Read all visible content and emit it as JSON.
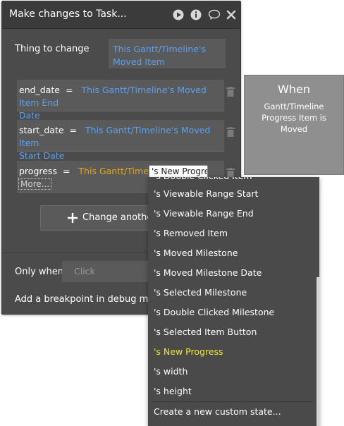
{
  "panel": {
    "title": "Make changes to Task...",
    "thing_label": "Thing to change",
    "thing_value_line1": "This Gantt/Timeline's",
    "thing_value_line2": "Moved Item",
    "fields": [
      {
        "name": "end_date",
        "op": "=",
        "expr_line1": "This Gantt/Timeline's Moved Item End",
        "expr_line2": "Date"
      },
      {
        "name": "start_date",
        "op": "=",
        "expr_line1": "This Gantt/Timeline's Moved Item",
        "expr_line2": "Start Date"
      },
      {
        "name": "progress",
        "op": "=",
        "expr_prefix": "This Gantt/Timeline",
        "expr_editing": "'s New Progre"
      }
    ],
    "more_label": "More...",
    "change_another_label": "Change another",
    "only_when_label": "Only when",
    "only_when_placeholder": "Click",
    "breakpoint_label": "Add a breakpoint in debug mode"
  },
  "when_box": {
    "title": "When",
    "line1": "Gantt/Timeline",
    "line2": "Progress Item is",
    "line3": "Moved"
  },
  "dropdown": {
    "items": [
      "'s Viewable Range Start",
      "'s Viewable Range End",
      "'s Removed Item",
      "'s Moved Milestone",
      "'s Moved Milestone Date",
      "'s Selected Milestone",
      "'s Double Clicked Milestone",
      "'s Selected Item Button",
      "'s New Progress",
      "'s width",
      "'s height"
    ],
    "highlighted_index": 8,
    "highlight_color": "#f5e532",
    "create_state_label": "Create a new custom state..."
  },
  "colors": {
    "panel_bg": "#4b4b4b",
    "expression_blue": "#5aa0ef",
    "expression_yellow": "#e3a51c"
  }
}
